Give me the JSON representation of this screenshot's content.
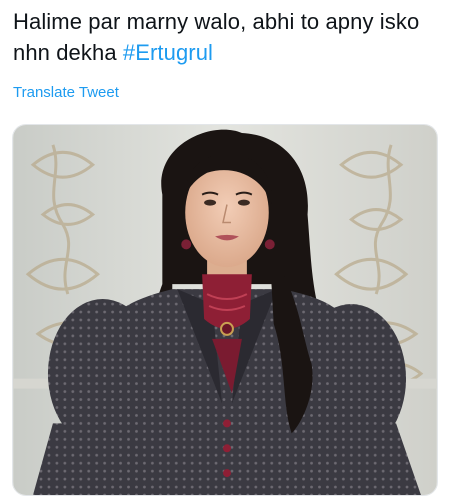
{
  "tweet": {
    "text_main": "Halime par marny walo, abhi to apny isko nhn dekha ",
    "hashtag": "#Ertugrul",
    "translate_label": "Translate Tweet"
  },
  "media": {
    "icon": "photo-of-woman-in-ornate-dress"
  },
  "colors": {
    "link": "#1d9bf0",
    "text": "#0f1419"
  }
}
